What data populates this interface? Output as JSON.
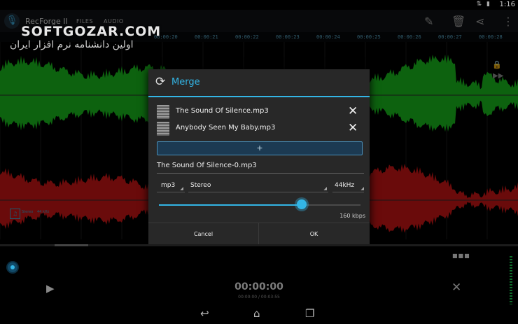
{
  "status": {
    "time": "1:16",
    "icons": "⇅ ▮"
  },
  "app": {
    "title": "RecForge II",
    "tabs": [
      "FILES",
      "AUDIO"
    ],
    "watermark": "SOFTGOZAR.COM",
    "watermark_sub": "اولین دانشنامه نرم افزار ایران",
    "action_icons": [
      "pencil-icon",
      "trash-icon",
      "share-icon",
      "overflow-icon"
    ]
  },
  "timeline": {
    "ticks": [
      "00:00:20",
      "00:00:21",
      "00:00:22",
      "00:00:23",
      "00:00:24",
      "00:00:25",
      "00:00:26",
      "00:00:27",
      "00:00:28"
    ]
  },
  "track": {
    "mode": "Stereo",
    "rate": "44 kHz"
  },
  "dialog": {
    "title": "Merge",
    "files": [
      {
        "name": "The Sound Of Silence.mp3"
      },
      {
        "name": "Anybody Seen My Baby.mp3"
      }
    ],
    "add_label": "+",
    "output_name": "The Sound Of Silence-0.mp3",
    "format": "mp3",
    "channels": "Stereo",
    "samplerate": "44kHz",
    "bitrate_fraction": 0.71,
    "bitrate_label": "160 kbps",
    "cancel": "Cancel",
    "ok": "OK"
  },
  "player": {
    "time": "00:00:00",
    "subtime": "00:00:00 / 00:03:55"
  },
  "colors": {
    "accent": "#33b5e5",
    "left_channel": "#18b31c",
    "right_channel": "#c21414"
  }
}
